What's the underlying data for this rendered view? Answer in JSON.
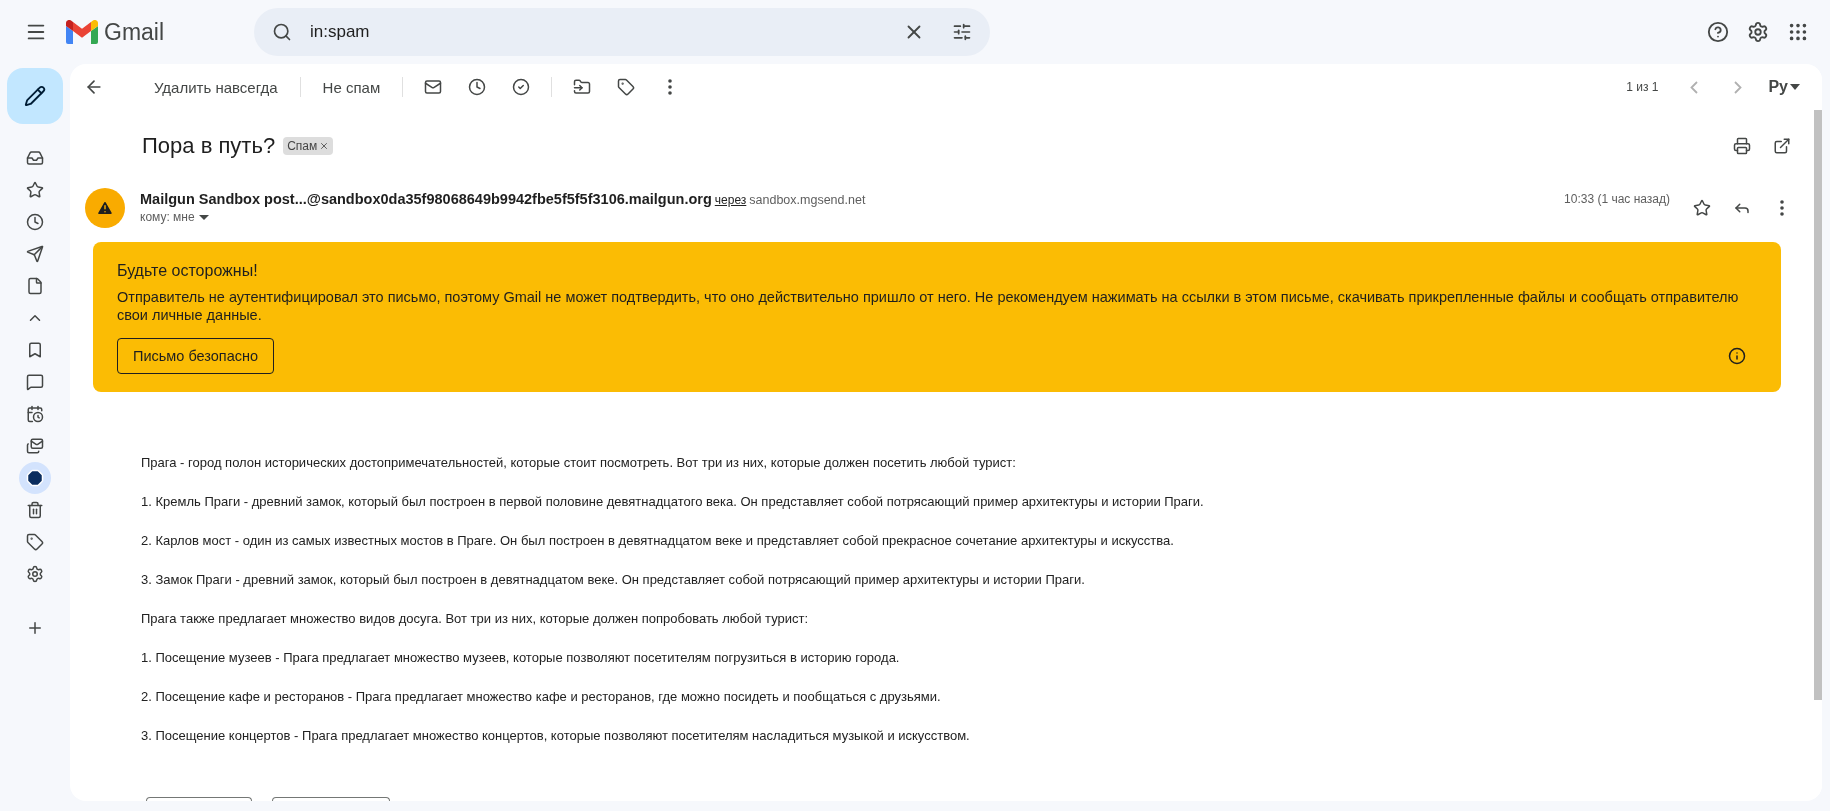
{
  "topbar": {
    "product": "Gmail",
    "search": {
      "value": "in:spam"
    }
  },
  "sidebar": {
    "items": [
      {
        "kind": "inbox",
        "selected": false
      },
      {
        "kind": "starred",
        "selected": false
      },
      {
        "kind": "snoozed",
        "selected": false
      },
      {
        "kind": "sent",
        "selected": false
      },
      {
        "kind": "drafts",
        "selected": false
      },
      {
        "kind": "less",
        "selected": false
      },
      {
        "kind": "important",
        "selected": false
      },
      {
        "kind": "chats",
        "selected": false
      },
      {
        "kind": "scheduled",
        "selected": false
      },
      {
        "kind": "all_mail",
        "selected": false
      },
      {
        "kind": "spam",
        "selected": true
      },
      {
        "kind": "trash",
        "selected": false
      },
      {
        "kind": "categories",
        "selected": false
      },
      {
        "kind": "manage_labels",
        "selected": false
      },
      {
        "kind": "create_label",
        "selected": false
      }
    ]
  },
  "toolbar": {
    "actions": [
      "Удалить навсегда",
      "Не спам"
    ],
    "pagination": "1 из 1",
    "input_language": "Ру"
  },
  "message": {
    "subject": "Пора в путь?",
    "label": "Спам",
    "sender": "Mailgun Sandbox post...@sandbox0da35f98068649b9942fbe5f5f5f3106.mailgun.org",
    "via": "через",
    "via_domain": "sandbox.mgsend.net",
    "recipient": "кому: мне",
    "time": "10:33 (1 час назад)",
    "starred": false
  },
  "warning": {
    "title": "Будьте осторожны!",
    "text": "Отправитель не аутентифицировал это письмо, поэтому Gmail не может подтвердить, что оно действительно пришло от него. Не рекомендуем нажимать на ссылки в этом письме, скачивать прикрепленные файлы и сообщать отправителю свои личные данные.",
    "button": "Письмо безопасно"
  },
  "body": {
    "paragraphs": [
      "Прага - город полон исторических достопримечательностей, которые стоит посмотреть. Вот три из них, которые должен посетить любой турист:",
      "1. Кремль Праги - древний замок, который был построен в первой половине девятнадцатого века. Он представляет собой потрясающий пример архитектуры и истории Праги.",
      "2. Карлов мост - один из самых известных мостов в Праге. Он был построен в девятнадцатом веке и представляет собой прекрасное сочетание архитектуры и искусства.",
      "3. Замок Праги - древний замок, который был построен в девятнадцатом веке. Он представляет собой потрясающий пример архитектуры и истории Праги.",
      "Прага также предлагает множество видов досуга. Вот три из них, которые должен попробовать любой турист:",
      "1. Посещение музеев - Прага предлагает множество музеев, которые позволяют посетителям погрузиться в историю города.",
      "2. Посещение кафе и ресторанов - Прага предлагает множество кафе и ресторанов, где можно посидеть и пообщаться с друзьями.",
      "3. Посещение концертов - Прага предлагает множество концертов, которые позволяют посетителям насладиться музыкой и искусством."
    ]
  }
}
